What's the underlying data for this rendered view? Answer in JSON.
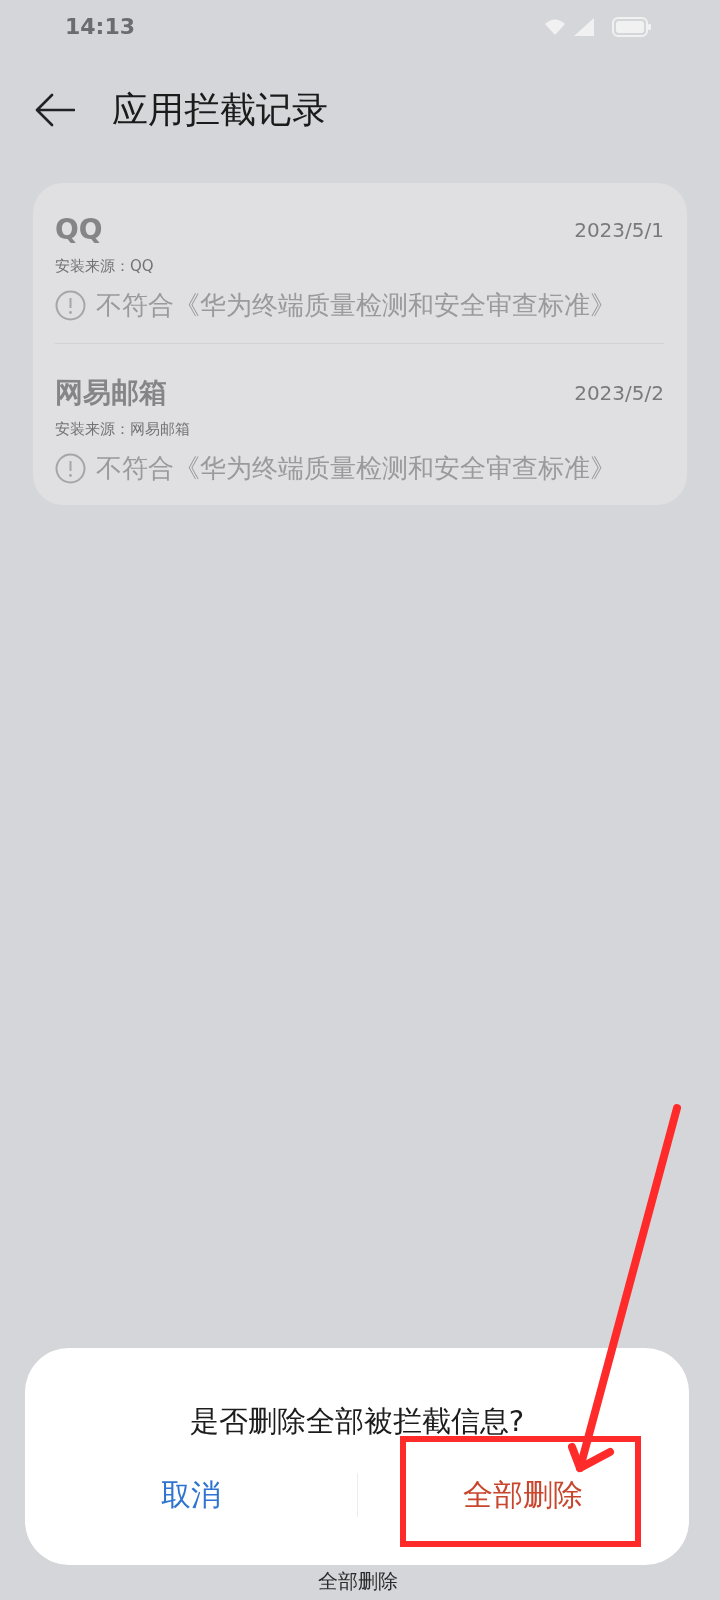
{
  "status_bar": {
    "time": "14:13"
  },
  "header": {
    "title": "应用拦截记录"
  },
  "records": [
    {
      "app": "QQ",
      "date": "2023/5/1",
      "source": "安装来源：QQ",
      "warning": "不符合《华为终端质量检测和安全审查标准》"
    },
    {
      "app": "网易邮箱",
      "date": "2023/5/2",
      "source": "安装来源：网易邮箱",
      "warning": "不符合《华为终端质量检测和安全审查标准》"
    }
  ],
  "bottom_action": {
    "label": "全部删除"
  },
  "dialog": {
    "message": "是否删除全部被拦截信息?",
    "buttons": [
      {
        "label": "取消",
        "kind": "cancel"
      },
      {
        "label": "全部删除",
        "kind": "confirm"
      }
    ]
  }
}
